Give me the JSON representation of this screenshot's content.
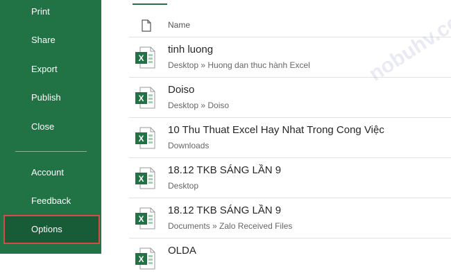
{
  "sidebar": {
    "items": [
      {
        "label": "Print"
      },
      {
        "label": "Share"
      },
      {
        "label": "Export"
      },
      {
        "label": "Publish"
      },
      {
        "label": "Close"
      },
      {
        "label": "Account"
      },
      {
        "label": "Feedback"
      },
      {
        "label": "Options",
        "selected": true
      }
    ],
    "background_color": "#217346",
    "selected_color": "#185c37",
    "highlight_border_color": "#d84a4a"
  },
  "file_list": {
    "header_icon": "document-icon",
    "column_name": "Name",
    "file_icon": "excel-file-icon",
    "files": [
      {
        "name": "tinh luong",
        "path": "Desktop » Huong dan thuc hành Excel"
      },
      {
        "name": "Doiso",
        "path": "Desktop » Doiso"
      },
      {
        "name": "10 Thu Thuat Excel Hay Nhat Trong Cong Việc",
        "path": "Downloads"
      },
      {
        "name": "18.12 TKB SÁNG  LẦN 9",
        "path": "Desktop"
      },
      {
        "name": "18.12 TKB SÁNG  LẦN 9",
        "path": "Documents » Zalo Received Files"
      },
      {
        "name": "OLDA",
        "path": ""
      }
    ]
  },
  "watermark": "nobuhv.com"
}
